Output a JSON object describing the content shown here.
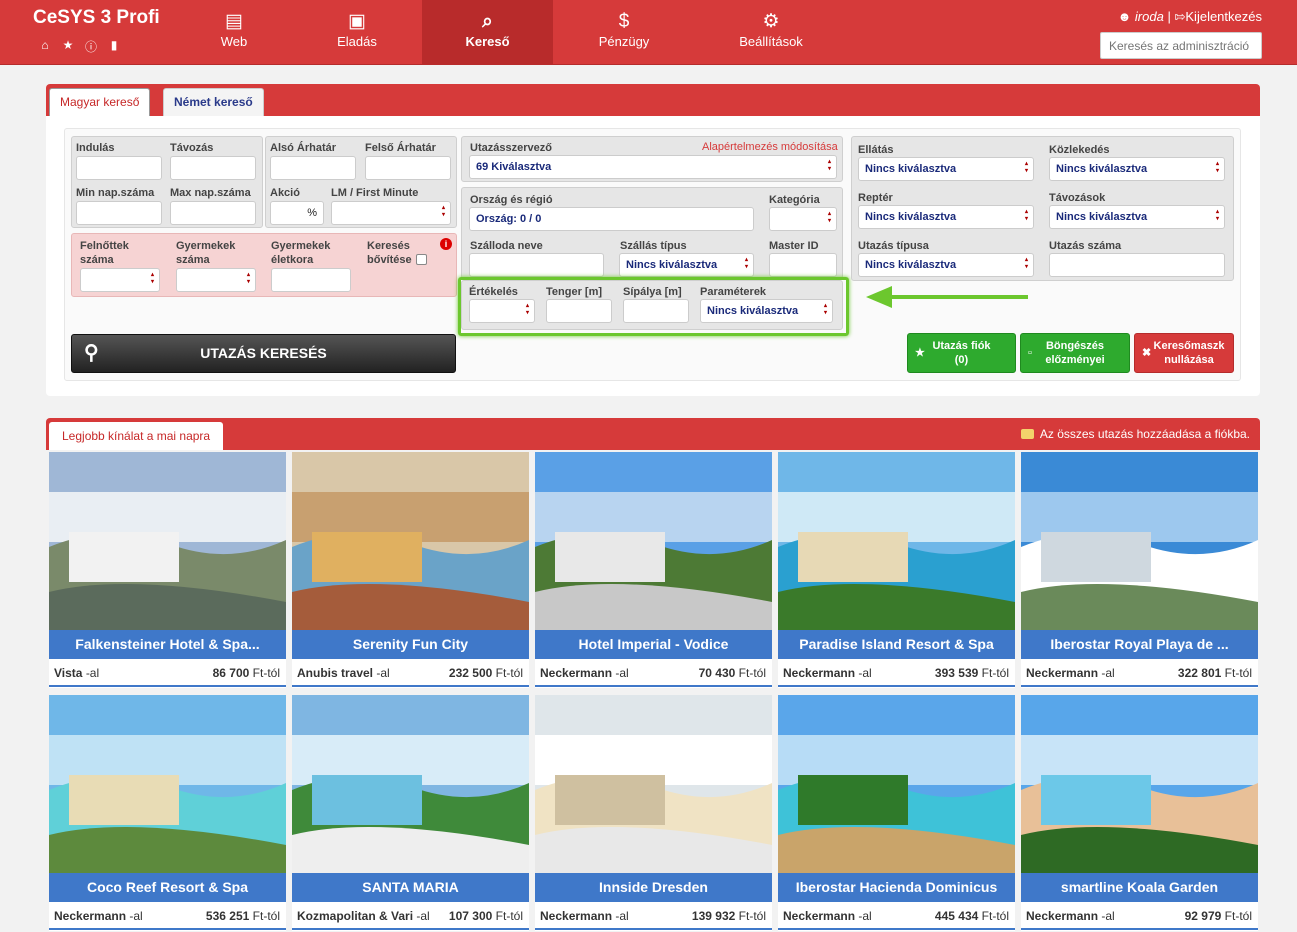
{
  "app": {
    "brand": "CeSYS 3 Profi"
  },
  "brand_icons": [
    "home-icon",
    "star-icon",
    "info-icon",
    "chat-icon"
  ],
  "nav": [
    {
      "label": "Web",
      "icon": "list-icon",
      "glyph": "▤"
    },
    {
      "label": "Eladás",
      "icon": "briefcase-icon",
      "glyph": "▣"
    },
    {
      "label": "Kereső",
      "icon": "search-icon",
      "glyph": "⌕",
      "active": true
    },
    {
      "label": "Pénzügy",
      "icon": "dollar-icon",
      "glyph": "$"
    },
    {
      "label": "Beállítások",
      "icon": "gear-icon",
      "glyph": "⚙"
    }
  ],
  "user": {
    "name": "iroda",
    "separator": "|",
    "logout": "Kijelentkezés"
  },
  "admin_search": {
    "placeholder": "Keresés az adminisztráció"
  },
  "tabs": {
    "hungarian": "Magyar kereső",
    "german": "Német kereső"
  },
  "form": {
    "departure": "Indulás",
    "return": "Távozás",
    "min_nights": "Min nap.száma",
    "max_nights": "Max nap.száma",
    "price_low": "Alsó Árhatár",
    "price_high": "Felső Árhatár",
    "discount": "Akció",
    "discount_unit": "%",
    "lastminute": "LM / First Minute",
    "adults": "Felnőttek száma",
    "children": "Gyermekek száma",
    "child_age": "Gyermekek életkora",
    "extend": "Keresés bővítése",
    "organizer": "Utazásszervező",
    "organizer_link": "Alapértelmezés módosítása",
    "organizer_value": "69 Kiválasztva",
    "country": "Ország és régió",
    "country_value": "Ország: 0 / 0",
    "category": "Kategória",
    "hotel": "Szálloda neve",
    "accommodation": "Szállás típus",
    "accommodation_value": "Nincs kiválasztva",
    "master_id": "Master ID",
    "rating": "Értékelés",
    "sea": "Tenger [m]",
    "ski": "Sípálya [m]",
    "params": "Paraméterek",
    "params_value": "Nincs kiválasztva",
    "board": "Ellátás",
    "board_value": "Nincs kiválasztva",
    "transport": "Közlekedés",
    "transport_value": "Nincs kiválasztva",
    "airport": "Reptér",
    "airport_value": "Nincs kiválasztva",
    "departures": "Távozások",
    "departures_value": "Nincs kiválasztva",
    "trip_type": "Utazás típusa",
    "trip_type_value": "Nincs kiválasztva",
    "trip_no": "Utazás száma"
  },
  "buttons": {
    "search": "UTAZÁS KERESÉS",
    "account": "Utazás fiók",
    "account_count": "(0)",
    "history_1": "Böngészés",
    "history_2": "előzményei",
    "reset_1": "Keresőmaszk",
    "reset_2": "nullázása"
  },
  "offers": {
    "tab": "Legjobb kínálat a mai napra",
    "add_all": "Az összes utazás hozzáadása a fiókba.",
    "from_suffix": "Ft-tól",
    "agency_suffix": "-al",
    "items": [
      {
        "title": "Falkensteiner Hotel & Spa...",
        "agency": "Vista",
        "price": "86 700"
      },
      {
        "title": "Serenity Fun City",
        "agency": "Anubis travel",
        "price": "232 500"
      },
      {
        "title": "Hotel Imperial - Vodice",
        "agency": "Neckermann",
        "price": "70 430"
      },
      {
        "title": "Paradise Island Resort & Spa",
        "agency": "Neckermann",
        "price": "393 539"
      },
      {
        "title": "Iberostar Royal Playa de ...",
        "agency": "Neckermann",
        "price": "322 801"
      },
      {
        "title": "Coco Reef Resort & Spa",
        "agency": "Neckermann",
        "price": "536 251"
      },
      {
        "title": "SANTA MARIA",
        "agency": "Kozmapolitan & Vari",
        "price": "107 300"
      },
      {
        "title": "Innside Dresden",
        "agency": "Neckermann",
        "price": "139 932"
      },
      {
        "title": "Iberostar Hacienda Dominicus",
        "agency": "Neckermann",
        "price": "445 434"
      },
      {
        "title": "smartline Koala Garden",
        "agency": "Neckermann",
        "price": "92 979"
      }
    ]
  },
  "colors": {
    "primary": "#d63a3a",
    "card_blue": "#3f78c9",
    "highlight": "#6cc72e",
    "button_green": "#2eaa2e"
  }
}
